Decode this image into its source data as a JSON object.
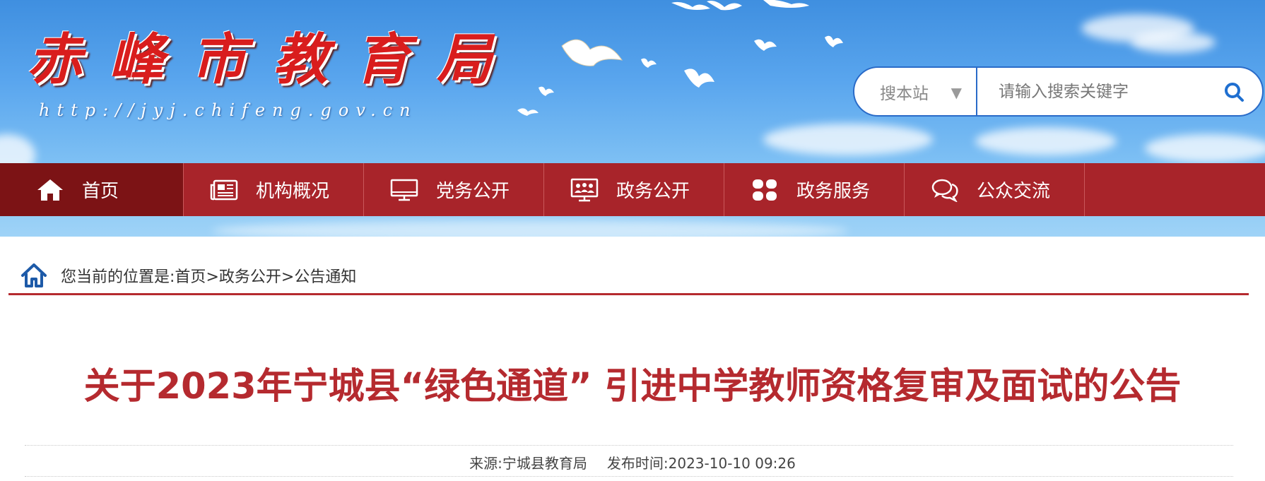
{
  "site": {
    "title": "赤峰市教育局",
    "url": "http://jyj.chifeng.gov.cn"
  },
  "search": {
    "scope_label": "搜本站",
    "placeholder": "请输入搜索关键字",
    "scope_icon": "triangle-down-icon",
    "button_icon": "search-icon"
  },
  "nav": {
    "items": [
      {
        "label": "首页",
        "icon": "home-icon"
      },
      {
        "label": "机构概况",
        "icon": "newspaper-icon"
      },
      {
        "label": "党务公开",
        "icon": "monitor-icon"
      },
      {
        "label": "政务公开",
        "icon": "meeting-icon"
      },
      {
        "label": "政务服务",
        "icon": "grid-icon"
      },
      {
        "label": "公众交流",
        "icon": "chat-icon"
      }
    ]
  },
  "breadcrumb": {
    "prefix": "您当前的位置是:",
    "items": [
      "首页",
      "政务公开",
      "公告通知"
    ],
    "separator": ">"
  },
  "article": {
    "title": "关于2023年宁城县“绿色通道” 引进中学教师资格复审及面试的公告",
    "source_label": "来源:",
    "source": "宁城县教育局",
    "date_label": "发布时间:",
    "date": "2023-10-10 09:26"
  },
  "colors": {
    "nav_bg": "#a8242a",
    "nav_active": "#7c1315",
    "title_red": "#b52a2f",
    "search_border": "#2a6bc8"
  }
}
